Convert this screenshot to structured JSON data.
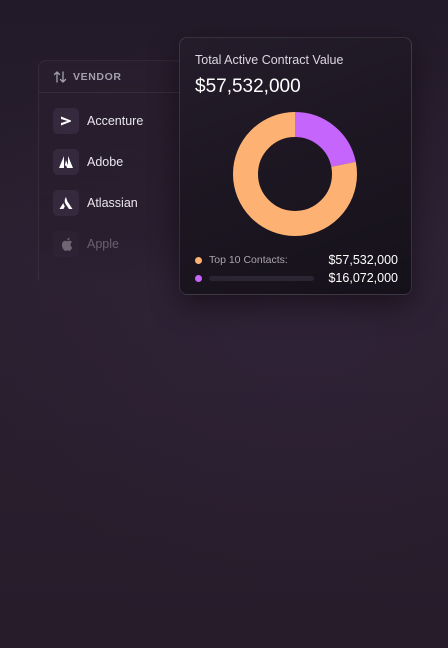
{
  "vendor_panel": {
    "header_label": "VENDOR",
    "header_icon": "sort-arrows-icon",
    "vendors": [
      {
        "name": "Accenture",
        "icon": "accenture-logo-icon"
      },
      {
        "name": "Adobe",
        "icon": "adobe-logo-icon"
      },
      {
        "name": "Atlassian",
        "icon": "atlassian-logo-icon"
      },
      {
        "name": "Apple",
        "icon": "apple-logo-icon"
      }
    ]
  },
  "contract_card": {
    "title": "Total Active Contract Value",
    "total_value": "$57,532,000",
    "legend": [
      {
        "label": "Top 10 Contacts:",
        "amount": "$57,532,000",
        "color": "#fdb274"
      },
      {
        "label": "",
        "amount": "$16,072,000",
        "color": "#c665fb"
      }
    ]
  },
  "chart_data": {
    "type": "pie",
    "donut": true,
    "slices": [
      {
        "label": "Top 10 Contacts",
        "value": 57532000,
        "color": "#fdb274"
      },
      {
        "label": "",
        "value": 16072000,
        "color": "#c665fb"
      }
    ]
  },
  "colors": {
    "background": "#261d2b",
    "card_background": "#1b151f",
    "orange": "#fdb274",
    "purple": "#c665fb"
  }
}
